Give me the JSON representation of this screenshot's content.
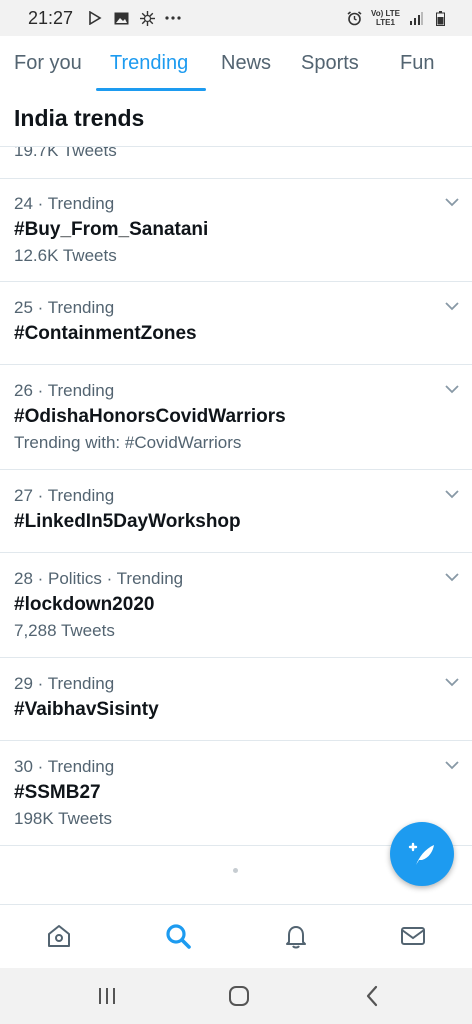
{
  "status_bar": {
    "time": "21:27",
    "left_icons": [
      "play-store-icon",
      "image-icon",
      "gear-icon",
      "more-icon"
    ],
    "network_top": "Vo) LTE",
    "network_bottom": "LTE1",
    "right_icons": [
      "alarm-icon",
      "signal-icon",
      "battery-icon"
    ]
  },
  "tabs": [
    {
      "label": "For you",
      "active": false
    },
    {
      "label": "Trending",
      "active": true
    },
    {
      "label": "News",
      "active": false
    },
    {
      "label": "Sports",
      "active": false
    },
    {
      "label": "Fun",
      "active": false
    }
  ],
  "section": {
    "title": "India trends"
  },
  "partial_row": {
    "text": "19.7K Tweets"
  },
  "trends": [
    {
      "meta": "24 · Trending",
      "name": "#Buy_From_Sanatani",
      "sub": "12.6K Tweets"
    },
    {
      "meta": "25 · Trending",
      "name": "#ContainmentZones",
      "sub": ""
    },
    {
      "meta": "26 · Trending",
      "name": "#OdishaHonorsCovidWarriors",
      "sub": "Trending with: #CovidWarriors"
    },
    {
      "meta": "27 · Trending",
      "name": "#LinkedIn5DayWorkshop",
      "sub": ""
    },
    {
      "meta": "28 · Politics · Trending",
      "name": "#lockdown2020",
      "sub": "7,288 Tweets"
    },
    {
      "meta": "29 · Trending",
      "name": "#VaibhavSisinty",
      "sub": ""
    },
    {
      "meta": "30 · Trending",
      "name": "#SSMB27",
      "sub": "198K Tweets"
    }
  ],
  "fab": {
    "icon": "compose-tweet-icon"
  },
  "bottom_nav": [
    {
      "icon": "home-icon",
      "active": false
    },
    {
      "icon": "search-icon",
      "active": true
    },
    {
      "icon": "notifications-bell-icon",
      "active": false
    },
    {
      "icon": "messages-envelope-icon",
      "active": false
    }
  ],
  "system_nav": [
    "recent-apps-icon",
    "home-circle-icon",
    "back-icon"
  ],
  "colors": {
    "accent": "#1d9bf0",
    "text_primary": "#0f1419",
    "text_secondary": "#536471",
    "divider": "#e1e8ed"
  }
}
